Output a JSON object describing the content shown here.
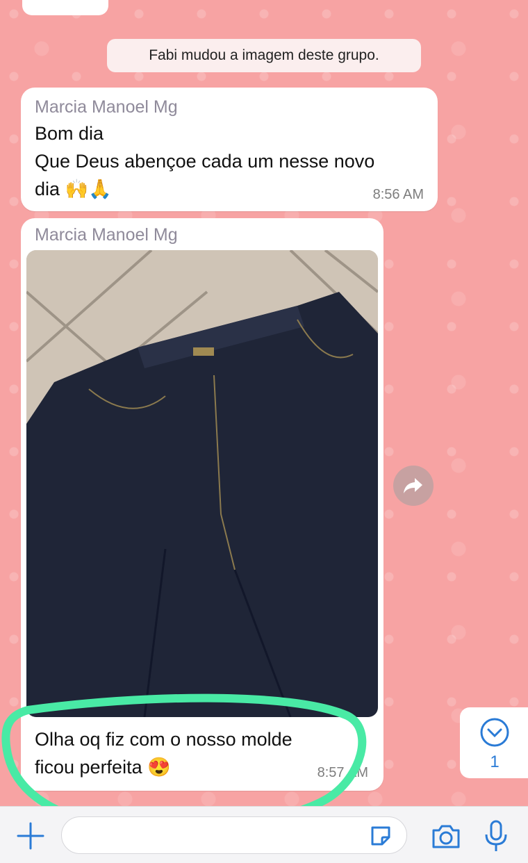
{
  "system_message": "Fabi mudou a imagem deste grupo.",
  "messages": [
    {
      "sender": "Marcia Manoel Mg",
      "text": "Bom dia\nQue Deus abençoe cada um nesse novo\ndia 🙌🙏",
      "time": "8:56 AM"
    },
    {
      "sender": "Marcia Manoel Mg",
      "caption": "Olha oq fiz com o nosso molde\nficou perfeita 😍",
      "time": "8:57 AM"
    }
  ],
  "scroll_down": {
    "unread_count": "1"
  },
  "composer": {
    "placeholder": ""
  },
  "colors": {
    "wallpaper": "#f7a3a3",
    "highlight": "#49eaa5",
    "accent": "#2a7bd6"
  }
}
